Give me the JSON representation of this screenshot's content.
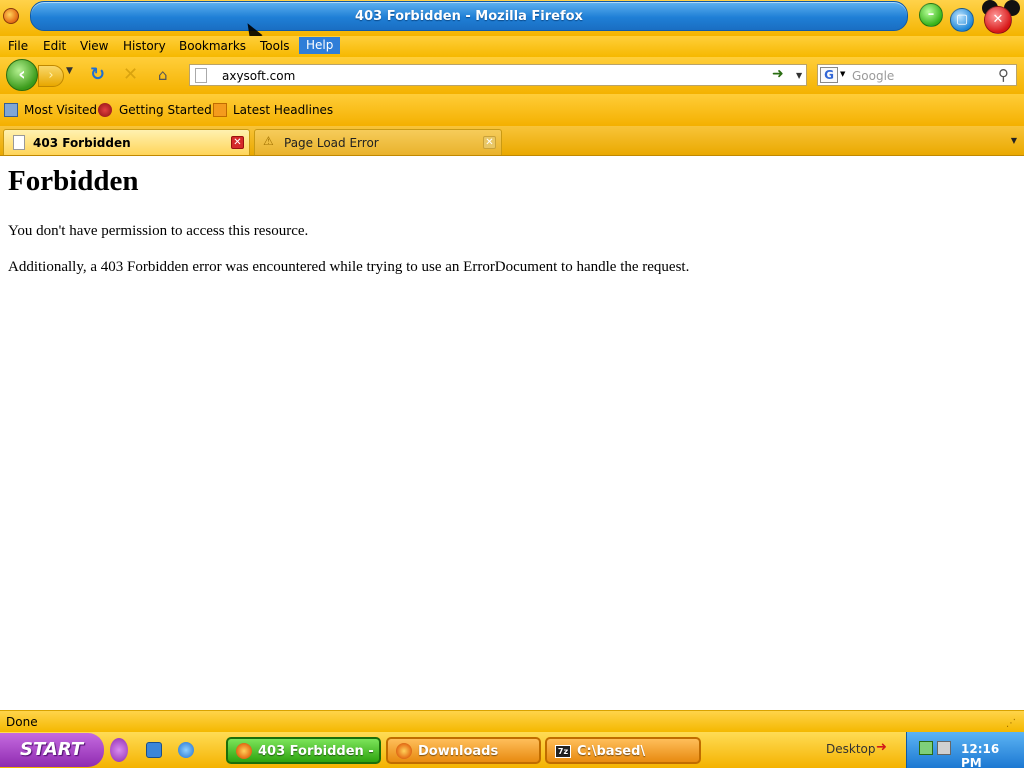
{
  "window": {
    "title": "403 Forbidden - Mozilla Firefox"
  },
  "menu": [
    "File",
    "Edit",
    "View",
    "History",
    "Bookmarks",
    "Tools",
    "Help"
  ],
  "navigation": {
    "url": "axysoft.com",
    "search_placeholder": "Google"
  },
  "bookmarks": [
    "Most Visited",
    "Getting Started",
    "Latest Headlines"
  ],
  "tabs": [
    {
      "label": "403 Forbidden",
      "active": true
    },
    {
      "label": "Page Load Error",
      "active": false
    }
  ],
  "page": {
    "heading": "Forbidden",
    "paragraph1": "You don't have permission to access this resource.",
    "paragraph2": "Additionally, a 403 Forbidden error was encountered while trying to use an ErrorDocument to handle the request."
  },
  "status": "Done",
  "taskbar": {
    "start": "START",
    "tasks": [
      "403 Forbidden - ...",
      "Downloads",
      "C:\\based\\"
    ],
    "desktop": "Desktop",
    "clock": "12:16 PM"
  },
  "colors": {
    "chrome_yellow": "#f4b400",
    "title_blue": "#1f7fd6",
    "start_purple": "#8f2bb0",
    "active_task_green": "#2ea30f"
  }
}
